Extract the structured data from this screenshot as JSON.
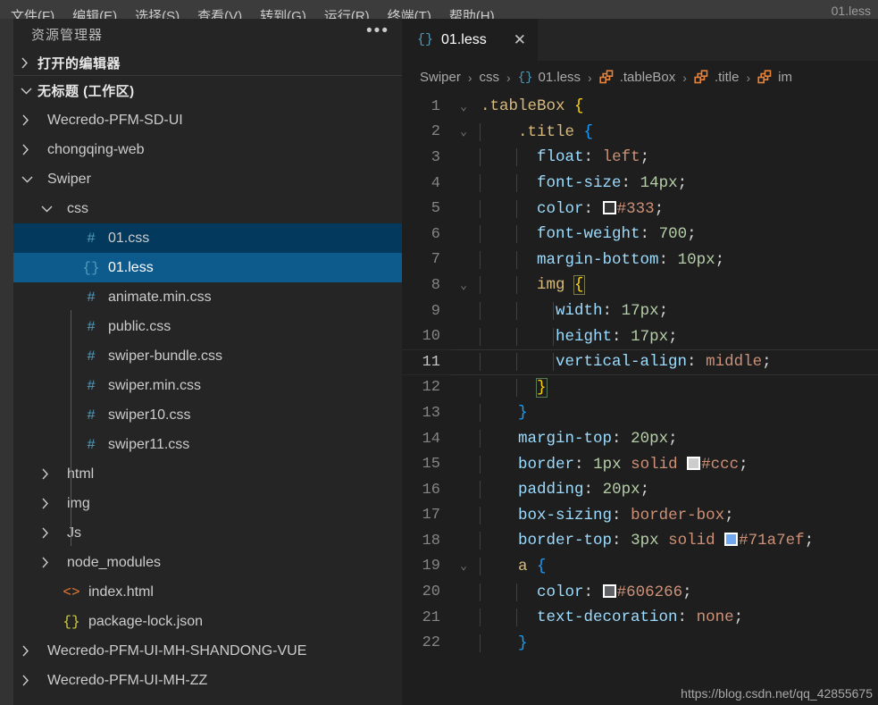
{
  "window": {
    "title": "01.less",
    "menu": [
      "文件(F)",
      "编辑(E)",
      "选择(S)",
      "查看(V)",
      "转到(G)",
      "运行(R)",
      "终端(T)",
      "帮助(H)"
    ]
  },
  "sidebar": {
    "header_title": "资源管理器",
    "ellipsis": "•••",
    "open_editors": {
      "label": "打开的编辑器",
      "chevron": "›",
      "expanded": false
    },
    "workspace": {
      "label": "无标题 (工作区)",
      "chevron": "⌄",
      "expanded": true
    },
    "tree": [
      {
        "label": "Wecredo-PFM-SD-UI",
        "type": "folder",
        "depth": 1,
        "expanded": false,
        "icon": "chevron-right-icon"
      },
      {
        "label": "chongqing-web",
        "type": "folder",
        "depth": 1,
        "expanded": false,
        "icon": "chevron-right-icon"
      },
      {
        "label": "Swiper",
        "type": "folder",
        "depth": 1,
        "expanded": true,
        "icon": "chevron-down-icon"
      },
      {
        "label": "css",
        "type": "folder",
        "depth": 2,
        "expanded": true,
        "icon": "chevron-down-icon"
      },
      {
        "label": "01.css",
        "type": "file",
        "depth": 3,
        "icon": "css-file-icon",
        "glyph": "#",
        "state": "selected-inactive"
      },
      {
        "label": "01.less",
        "type": "file",
        "depth": 3,
        "icon": "less-file-icon",
        "glyph": "{}",
        "state": "selected-active"
      },
      {
        "label": "animate.min.css",
        "type": "file",
        "depth": 3,
        "icon": "css-file-icon",
        "glyph": "#"
      },
      {
        "label": "public.css",
        "type": "file",
        "depth": 3,
        "icon": "css-file-icon",
        "glyph": "#"
      },
      {
        "label": "swiper-bundle.css",
        "type": "file",
        "depth": 3,
        "icon": "css-file-icon",
        "glyph": "#"
      },
      {
        "label": "swiper.min.css",
        "type": "file",
        "depth": 3,
        "icon": "css-file-icon",
        "glyph": "#"
      },
      {
        "label": "swiper10.css",
        "type": "file",
        "depth": 3,
        "icon": "css-file-icon",
        "glyph": "#"
      },
      {
        "label": "swiper11.css",
        "type": "file",
        "depth": 3,
        "icon": "css-file-icon",
        "glyph": "#"
      },
      {
        "label": "html",
        "type": "folder",
        "depth": 2,
        "expanded": false,
        "icon": "chevron-right-icon"
      },
      {
        "label": "img",
        "type": "folder",
        "depth": 2,
        "expanded": false,
        "icon": "chevron-right-icon"
      },
      {
        "label": "Js",
        "type": "folder",
        "depth": 2,
        "expanded": false,
        "icon": "chevron-right-icon"
      },
      {
        "label": "node_modules",
        "type": "folder",
        "depth": 2,
        "expanded": false,
        "icon": "chevron-right-icon"
      },
      {
        "label": "index.html",
        "type": "file",
        "depth": 2,
        "icon": "html-file-icon",
        "glyph": "<>"
      },
      {
        "label": "package-lock.json",
        "type": "file",
        "depth": 2,
        "icon": "json-file-icon",
        "glyph": "{}"
      },
      {
        "label": "Wecredo-PFM-UI-MH-SHANDONG-VUE",
        "type": "folder",
        "depth": 1,
        "expanded": false,
        "icon": "chevron-right-icon"
      },
      {
        "label": "Wecredo-PFM-UI-MH-ZZ",
        "type": "folder",
        "depth": 1,
        "expanded": false,
        "icon": "chevron-right-icon"
      }
    ]
  },
  "editor": {
    "tab": {
      "icon_glyph": "{}",
      "label": "01.less",
      "close_glyph": "✕",
      "active": true
    },
    "breadcrumbs": [
      {
        "label": "Swiper",
        "kind": "folder"
      },
      {
        "label": "css",
        "kind": "folder"
      },
      {
        "label": "01.less",
        "kind": "file",
        "glyph": "{}"
      },
      {
        "label": ".tableBox",
        "kind": "selector"
      },
      {
        "label": ".title",
        "kind": "selector"
      },
      {
        "label": "im",
        "kind": "selector",
        "truncated": true
      }
    ],
    "breadcrumb_separator": "›",
    "active_line": 11,
    "watermark": "https://blog.csdn.net/qq_42855675",
    "lines": [
      {
        "n": 1,
        "fold": "⌄",
        "indent_guides": []
      },
      {
        "n": 2,
        "fold": "⌄",
        "indent_guides": [
          0
        ]
      },
      {
        "n": 3,
        "fold": "",
        "indent_guides": [
          0,
          1
        ]
      },
      {
        "n": 4,
        "fold": "",
        "indent_guides": [
          0,
          1
        ]
      },
      {
        "n": 5,
        "fold": "",
        "indent_guides": [
          0,
          1
        ]
      },
      {
        "n": 6,
        "fold": "",
        "indent_guides": [
          0,
          1
        ]
      },
      {
        "n": 7,
        "fold": "",
        "indent_guides": [
          0,
          1
        ]
      },
      {
        "n": 8,
        "fold": "⌄",
        "indent_guides": [
          0,
          1
        ]
      },
      {
        "n": 9,
        "fold": "",
        "indent_guides": [
          0,
          1,
          2
        ]
      },
      {
        "n": 10,
        "fold": "",
        "indent_guides": [
          0,
          1,
          2
        ]
      },
      {
        "n": 11,
        "fold": "",
        "indent_guides": [
          0,
          1,
          2
        ]
      },
      {
        "n": 12,
        "fold": "",
        "indent_guides": [
          0,
          1
        ]
      },
      {
        "n": 13,
        "fold": "",
        "indent_guides": [
          0
        ]
      },
      {
        "n": 14,
        "fold": "",
        "indent_guides": [
          0
        ]
      },
      {
        "n": 15,
        "fold": "",
        "indent_guides": [
          0
        ]
      },
      {
        "n": 16,
        "fold": "",
        "indent_guides": [
          0
        ]
      },
      {
        "n": 17,
        "fold": "",
        "indent_guides": [
          0
        ]
      },
      {
        "n": 18,
        "fold": "",
        "indent_guides": [
          0
        ]
      },
      {
        "n": 19,
        "fold": "⌄",
        "indent_guides": [
          0
        ]
      },
      {
        "n": 20,
        "fold": "",
        "indent_guides": [
          0,
          1
        ]
      },
      {
        "n": 21,
        "fold": "",
        "indent_guides": [
          0,
          1
        ]
      },
      {
        "n": 22,
        "fold": "",
        "indent_guides": [
          0
        ]
      }
    ],
    "source_text": [
      ".tableBox {",
      "    .title {",
      "      float: left;",
      "      font-size: 14px;",
      "      color: #333;",
      "      font-weight: 700;",
      "      margin-bottom: 10px;",
      "      img {",
      "        width: 17px;",
      "        height: 17px;",
      "        vertical-align: middle;",
      "      }",
      "    }",
      "    margin-top: 20px;",
      "    border: 1px solid #ccc;",
      "    padding: 20px;",
      "    box-sizing: border-box;",
      "    border-top: 3px solid #71a7ef;",
      "    a {",
      "      color: #606266;",
      "      text-decoration: none;",
      "    }"
    ],
    "color_swatches": [
      {
        "line": 5,
        "value": "#333333",
        "text": "#333"
      },
      {
        "line": 15,
        "value": "#cccccc",
        "text": "#ccc"
      },
      {
        "line": 18,
        "value": "#71a7ef",
        "text": "#71a7ef"
      },
      {
        "line": 20,
        "value": "#606266",
        "text": "#606266"
      }
    ]
  },
  "theme": {
    "editor_bg": "#1e1e1e",
    "sidebar_bg": "#252526",
    "activitybar_bg": "#333333",
    "menubar_bg": "#3c3c3c",
    "selection_active": "#0d5a8c",
    "selection_inactive": "#04395e",
    "accent_blue": "#519aba",
    "selector_orange": "#e8833a"
  }
}
